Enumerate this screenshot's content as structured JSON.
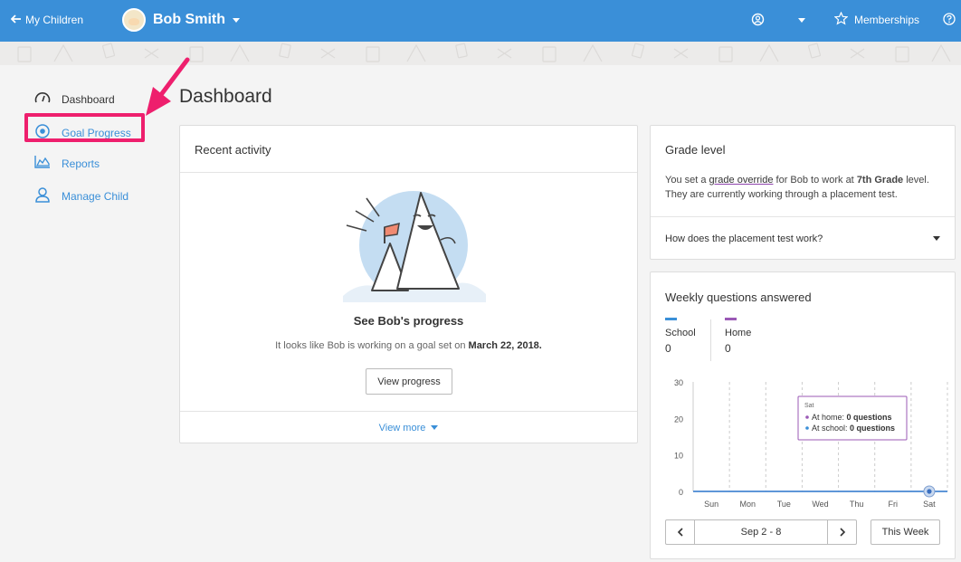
{
  "topbar": {
    "back_label": "My Children",
    "child_name": "Bob Smith",
    "memberships_label": "Memberships"
  },
  "sidebar": {
    "items": [
      {
        "label": "Dashboard",
        "icon": "gauge-icon"
      },
      {
        "label": "Goal Progress",
        "icon": "target-icon"
      },
      {
        "label": "Reports",
        "icon": "area-chart-icon"
      },
      {
        "label": "Manage Child",
        "icon": "person-icon"
      }
    ]
  },
  "main": {
    "title": "Dashboard"
  },
  "recent": {
    "title": "Recent activity",
    "progress_title": "See Bob's progress",
    "progress_text": "It looks like Bob is working on a goal set on",
    "progress_date": "March 22, 2018.",
    "view_progress_label": "View progress",
    "view_more_label": "View more"
  },
  "grade": {
    "title": "Grade level",
    "text_1": "You set a",
    "link": "grade override",
    "text_2": "for Bob to work at",
    "grade": "7th Grade",
    "text_3": "level.",
    "text_4": "They are currently working through a placement test.",
    "accordion_label": "How does the placement test work?"
  },
  "weekly": {
    "title": "Weekly questions answered",
    "legend": [
      {
        "label": "School",
        "value": "0",
        "color": "#3a8fd8"
      },
      {
        "label": "Home",
        "value": "0",
        "color": "#9b59b6"
      }
    ],
    "week_range": "Sep 2 - 8",
    "this_week_label": "This Week",
    "tooltip": {
      "day": "Sat",
      "home_prefix": "At home:",
      "home_value": "0 questions",
      "school_prefix": "At school:",
      "school_value": "0 questions"
    }
  },
  "chart_data": {
    "type": "line",
    "categories": [
      "Sun",
      "Mon",
      "Tue",
      "Wed",
      "Thu",
      "Fri",
      "Sat"
    ],
    "series": [
      {
        "name": "School",
        "values": [
          0,
          0,
          0,
          0,
          0,
          0,
          0
        ]
      },
      {
        "name": "Home",
        "values": [
          0,
          0,
          0,
          0,
          0,
          0,
          0
        ]
      }
    ],
    "y_ticks": [
      "0",
      "10",
      "20",
      "30"
    ],
    "ylim": [
      0,
      30
    ],
    "grid": true
  },
  "colors": {
    "brand": "#3a8fd8",
    "highlight": "#ee1f6d",
    "home": "#9b59b6"
  }
}
